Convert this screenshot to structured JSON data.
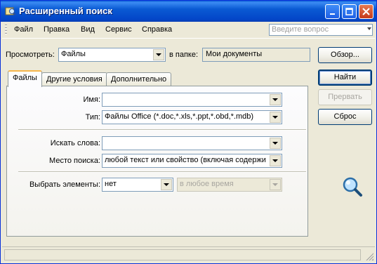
{
  "window": {
    "title": "Расширенный поиск",
    "icons": {
      "app": "search-app-icon",
      "minimize": "minimize-icon",
      "maximize": "maximize-icon",
      "close": "close-icon"
    }
  },
  "menu": {
    "items": [
      "Файл",
      "Правка",
      "Вид",
      "Сервис",
      "Справка"
    ],
    "help_placeholder": "Введите вопрос"
  },
  "look_in": {
    "label": "Просмотреть:",
    "value": "Файлы",
    "folder_label": "в папке:",
    "folder_value": "Мои документы",
    "browse_button": "Обзор..."
  },
  "tabs": [
    "Файлы",
    "Другие условия",
    "Дополнительно"
  ],
  "files_tab": {
    "name_label": "Имя:",
    "name_value": "",
    "type_label": "Тип:",
    "type_value": "Файлы Office (*.doc,*.xls,*.ppt,*.obd,*.mdb)",
    "search_words_label": "Искать слова:",
    "search_words_value": "",
    "search_location_label": "Место поиска:",
    "search_location_value": "любой текст или свойство (включая содержи",
    "select_items_label": "Выбрать элементы:",
    "select_items_value": "нет",
    "time_value": "в любое время"
  },
  "buttons": {
    "find": "Найти",
    "stop": "Прервать",
    "reset": "Сброс"
  },
  "colors": {
    "titlebar": "#0a5ad3",
    "window_bg": "#ece9d8",
    "tab_accent": "#f7b64b"
  }
}
